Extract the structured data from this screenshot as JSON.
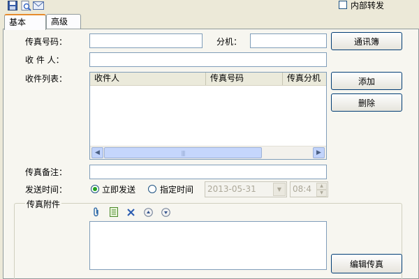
{
  "toolbar": {
    "save_icon": "floppy-disk-icon",
    "preview_icon": "magnifier-page-icon",
    "mail_icon": "envelope-icon"
  },
  "internal_forward": {
    "label": "内部转发",
    "checked": false
  },
  "tabs": [
    {
      "label": "基本",
      "active": true
    },
    {
      "label": "高级",
      "active": false
    }
  ],
  "form": {
    "fax_number_label": "传真号码：",
    "fax_number_value": "",
    "extension_label": "分机：",
    "extension_value": "",
    "recipient_label": "收 件 人：",
    "recipient_value": "",
    "recipient_list_label": "收件列表：",
    "remark_label": "传真备注：",
    "remark_value": "",
    "send_time_label": "发送时间：",
    "attachment_label": "传真附件"
  },
  "buttons": {
    "address_book": "通讯簿",
    "add": "添加",
    "delete": "删除",
    "edit_fax": "编辑传真"
  },
  "recipient_table": {
    "columns": [
      "收件人",
      "传真号码",
      "传真分机"
    ],
    "rows": [],
    "scroll_grip": "|||"
  },
  "send_time": {
    "immediate_label": "立即发送",
    "scheduled_label": "指定时间",
    "selected": "immediate",
    "date_value": "2013-05-31",
    "time_value": "08:4"
  },
  "attachment_toolbar": {
    "icons": [
      "paperclip-icon",
      "document-icon",
      "delete-x-icon",
      "move-up-icon",
      "move-down-icon"
    ]
  },
  "colors": {
    "window_bg": "#ece9d8",
    "tab_accent": "#e68b2c",
    "input_border": "#7f9db9"
  }
}
